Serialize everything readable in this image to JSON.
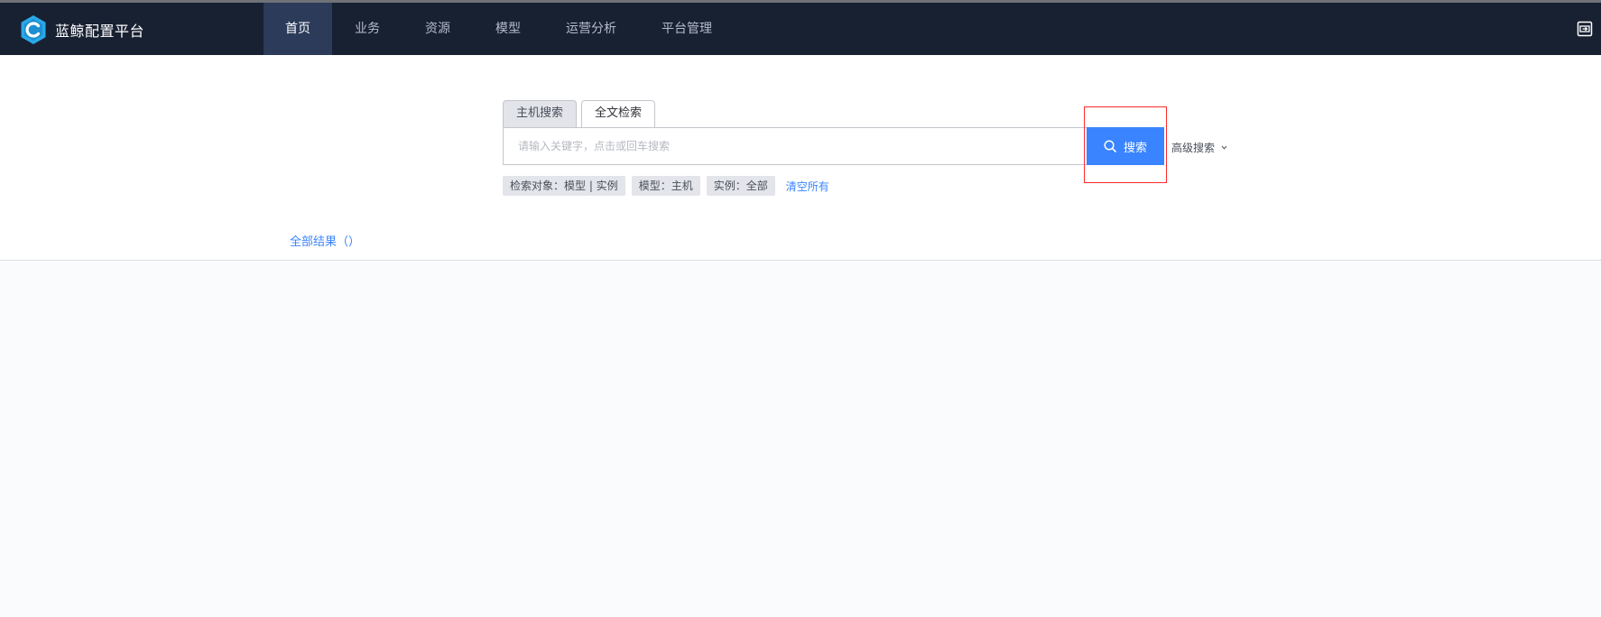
{
  "app": {
    "name": "蓝鲸配置平台"
  },
  "nav": {
    "items": [
      {
        "label": "首页",
        "active": true
      },
      {
        "label": "业务",
        "active": false
      },
      {
        "label": "资源",
        "active": false
      },
      {
        "label": "模型",
        "active": false
      },
      {
        "label": "运营分析",
        "active": false
      },
      {
        "label": "平台管理",
        "active": false
      }
    ]
  },
  "search": {
    "tabs": [
      {
        "label": "主机搜索",
        "active": false
      },
      {
        "label": "全文检索",
        "active": true
      }
    ],
    "placeholder": "请输入关键字，点击或回车搜索",
    "button_label": "搜索",
    "advanced_label": "高级搜索"
  },
  "filters": {
    "chips": [
      "检索对象：模型 | 实例",
      "模型：主机",
      "实例：全部"
    ],
    "clear_label": "清空所有"
  },
  "results": {
    "title": "全部结果（）"
  },
  "colors": {
    "topbar_bg": "#182132",
    "nav_active_bg": "#2b3b59",
    "primary": "#3a84ff",
    "highlight_border": "#ff2a2a",
    "chip_bg": "#e3e5ea"
  },
  "icons": {
    "brand": "bk-cmdb-logo-icon",
    "topbar_right": "exit-icon",
    "search_button": "search-icon",
    "advanced": "chevron-down-icon"
  }
}
